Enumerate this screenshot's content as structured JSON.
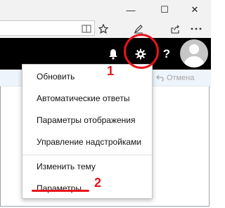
{
  "window": {
    "minimize_label": "—",
    "maximize_label": "☐",
    "close_label": "✕"
  },
  "appbar": {
    "help_label": "?"
  },
  "toolbar_undo": {
    "label": "Отмена"
  },
  "menu": {
    "items": [
      {
        "label": "Обновить"
      },
      {
        "label": "Автоматические ответы"
      },
      {
        "label": "Параметры отображения"
      },
      {
        "label": "Управление надстройками"
      },
      {
        "label": "Изменить тему"
      },
      {
        "label": "Параметры"
      }
    ]
  },
  "annotations": {
    "step1": "1",
    "step2": "2"
  },
  "icons": {
    "bell": "bell-icon",
    "gear": "gear-icon",
    "help": "help-icon",
    "avatar": "avatar-icon",
    "undo": "undo-icon"
  },
  "colors": {
    "appbar_bg": "#000000",
    "annotation": "#e8141c"
  }
}
